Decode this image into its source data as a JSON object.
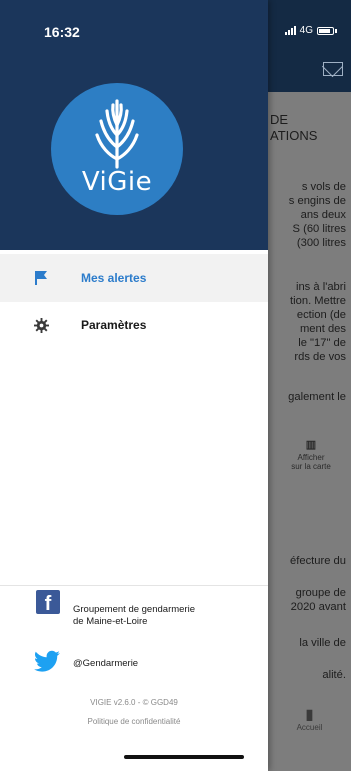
{
  "status": {
    "time": "16:32",
    "network": "4G"
  },
  "background": {
    "title": "DE\nATIONS",
    "paragraphs": [
      "s vols de\ns engins de\nans deux\nS (60 litres\n(300 litres",
      "ins à l'abri\ntion. Mettre\nection (de\nment des\nle \"17\" de\nrds de vos",
      "galement le"
    ],
    "map_button": {
      "line1": "Afficher",
      "line2": "sur la carte"
    },
    "paragraphs2": [
      "éfecture du",
      "groupe de\n2020 avant",
      "la ville de",
      "alité."
    ],
    "home_label": "Accueil"
  },
  "drawer": {
    "logo_text": "ViGie",
    "menu": [
      {
        "label": "Mes alertes",
        "icon": "flag-icon",
        "active": true
      },
      {
        "label": "Paramètres",
        "icon": "gear-icon",
        "active": false
      }
    ],
    "footer": {
      "facebook": "Groupement de gendarmerie\nde Maine-et-Loire",
      "twitter": "@Gendarmerie",
      "version": "VIGIE v2.6.0 - © GGD49",
      "privacy": "Politique de confidentialité"
    }
  },
  "colors": {
    "drawer_header": "#1b365b",
    "logo_blue": "#2d7ec4",
    "accent": "#2c7ccb",
    "facebook": "#3b5998",
    "twitter": "#1da1f2"
  }
}
